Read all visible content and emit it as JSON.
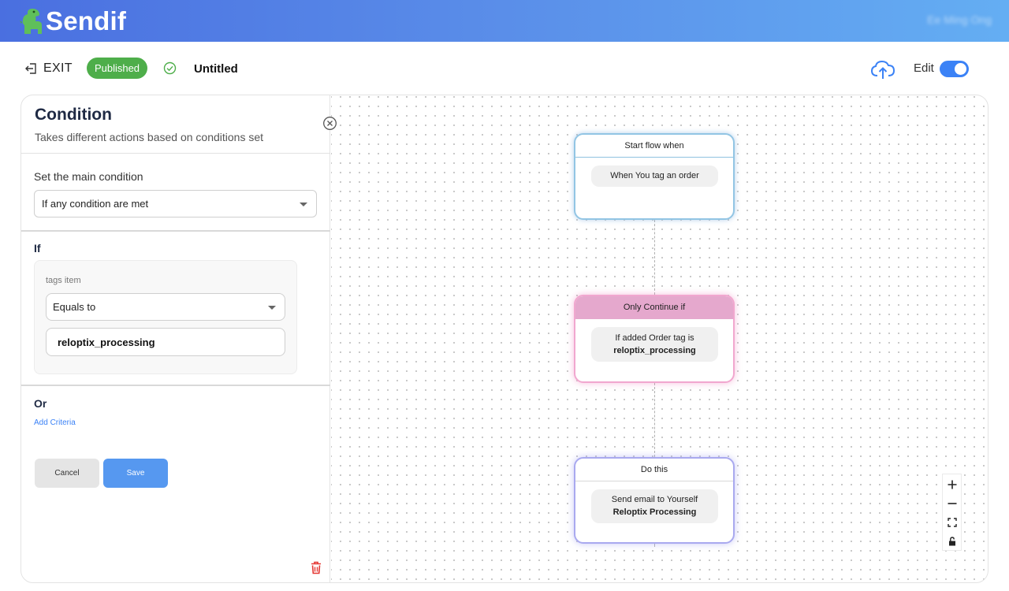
{
  "header": {
    "brand": "Sendif",
    "user_name": "Ee Ming Ong"
  },
  "toolbar": {
    "exit_label": "EXIT",
    "status_badge": "Published",
    "flow_title": "Untitled",
    "edit_label": "Edit",
    "edit_enabled": true
  },
  "panel": {
    "title": "Condition",
    "subtitle": "Takes different actions based on conditions set",
    "main_condition_label": "Set the main condition",
    "main_condition_value": "If any condition are met",
    "if_label": "If",
    "field_label": "tags item",
    "operator_value": "Equals to",
    "value": "reloptix_processing",
    "or_label": "Or",
    "add_criteria": "Add Criteria",
    "cancel_label": "Cancel",
    "save_label": "Save"
  },
  "flow": {
    "start": {
      "header": "Start flow when",
      "text": "When You tag an order"
    },
    "condition": {
      "header": "Only Continue if",
      "line1": "If added Order tag is",
      "line2": "reloptix_processing"
    },
    "action": {
      "header": "Do this",
      "line1": "Send email to Yourself",
      "line2": "Reloptix Processing"
    }
  },
  "colors": {
    "header_gradient_start": "#4a6fe0",
    "header_gradient_end": "#64aef3",
    "published": "#4eae4a",
    "accent": "#3b82f6",
    "save": "#5698f0",
    "delete": "#e53935"
  },
  "icons": {
    "logo": "dinosaur-logo-icon",
    "exit": "exit-icon",
    "status": "check-circle-icon",
    "upload": "cloud-upload-icon",
    "close": "close-circle-icon",
    "delete": "trash-icon",
    "zoom_in": "plus-icon",
    "zoom_out": "minus-icon",
    "fit": "fit-view-icon",
    "lock": "lock-icon"
  }
}
